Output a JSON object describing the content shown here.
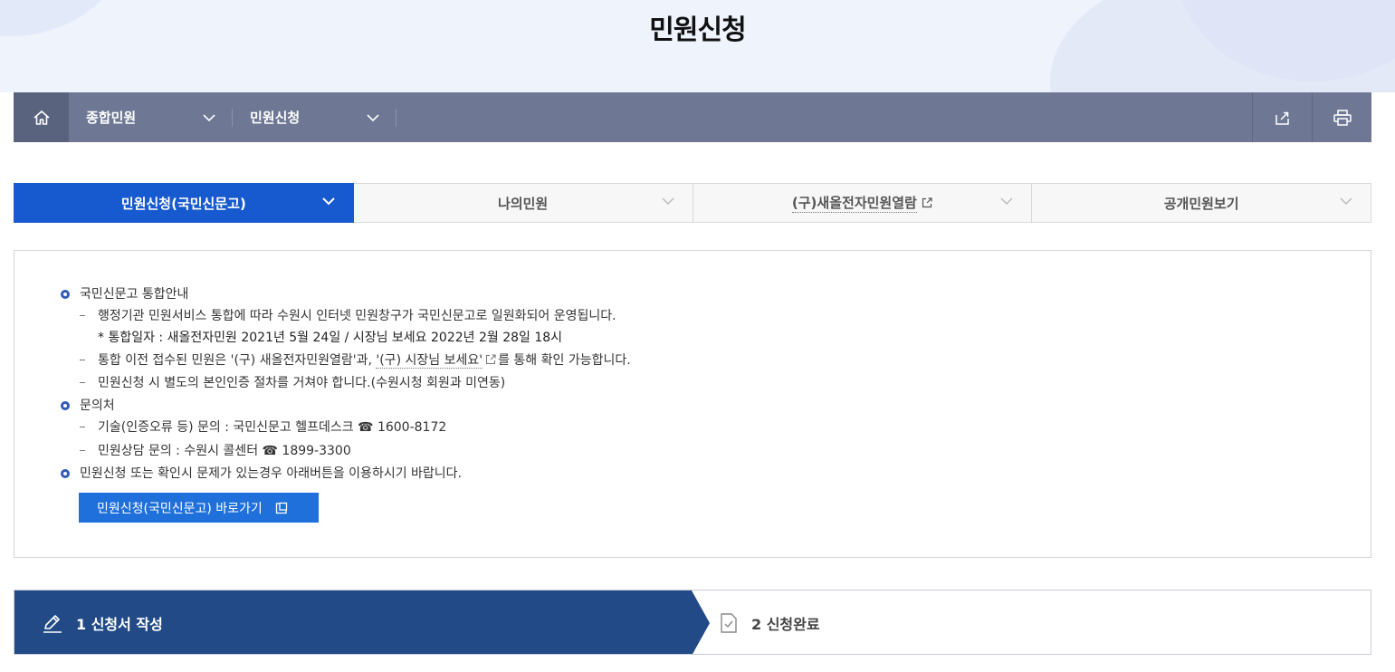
{
  "page": {
    "title": "민원신청"
  },
  "breadcrumb": {
    "level1": "종합민원",
    "level2": "민원신청"
  },
  "tabs": [
    {
      "label": "민원신청(국민신문고)",
      "active": true
    },
    {
      "label": "나의민원",
      "active": false
    },
    {
      "label": "(구)새올전자민원열람",
      "active": false,
      "external": true
    },
    {
      "label": "공개민원보기",
      "active": false
    }
  ],
  "notice": {
    "section1": {
      "title": "국민신문고 통합안내",
      "line1": "행정기관 민원서비스 통합에 따라 수원시 인터넷 민원창구가 국민신문고로 일원화되어 운영됩니다.",
      "line1_sub": "* 통합일자 : 새올전자민원 2021년 5월 24일 / 시장님 보세요 2022년 2월 28일 18시",
      "line2_pre": "통합 이전 접수된 민원은 '(구) 새올전자민원열람'과, ",
      "line2_link": "'(구) 시장님 보세요'",
      "line2_post": "를 통해 확인 가능합니다.",
      "line3": "민원신청 시 별도의 본인인증 절차를 거쳐야 합니다.(수원시청 회원과 미연동)"
    },
    "section2": {
      "title": "문의처",
      "line1": "기술(인증오류 등) 문의 : 국민신문고 헬프데스크 ☎ 1600-8172",
      "line2": "민원상담 문의 : 수원시 콜센터 ☎ 1899-3300"
    },
    "section3": {
      "title": "민원신청 또는 확인시 문제가 있는경우 아래버튼을 이용하시기 바랍니다."
    },
    "button_label": "민원신청(국민신문고) 바로가기"
  },
  "steps": [
    {
      "label": "1 신청서 작성",
      "active": true
    },
    {
      "label": "2 신청완료",
      "active": false
    }
  ],
  "colors": {
    "accent": "#1759cf",
    "nav": "#6e7894",
    "step_active": "#214a86"
  }
}
